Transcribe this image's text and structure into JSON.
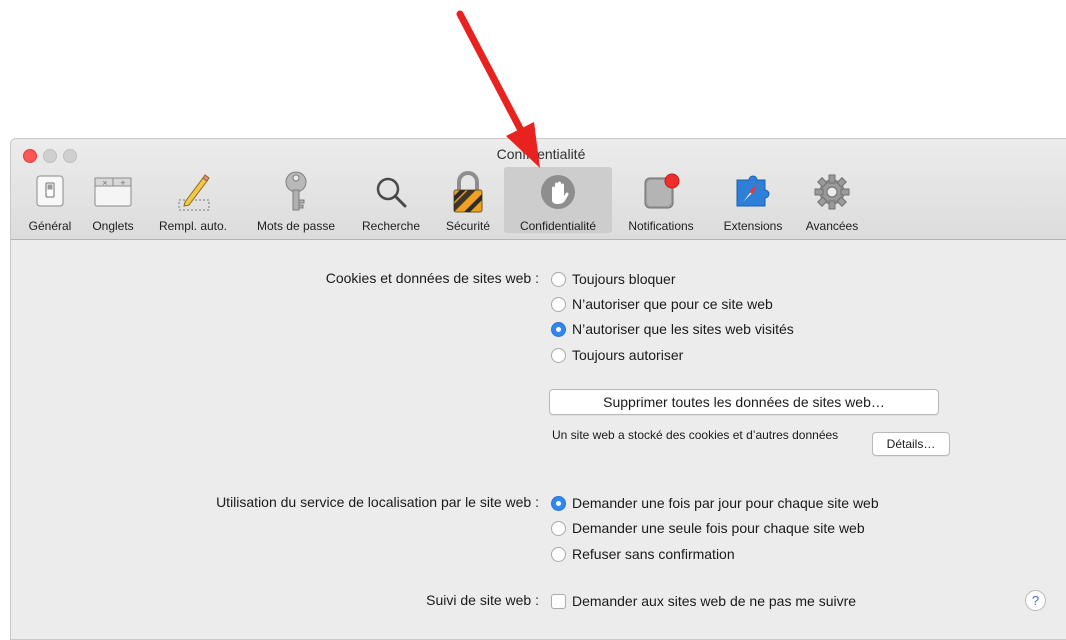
{
  "window": {
    "title": "Confidentialité"
  },
  "toolbar": {
    "items": [
      {
        "label": "Général",
        "icon": "general-switch-icon"
      },
      {
        "label": "Onglets",
        "icon": "tabs-icon"
      },
      {
        "label": "Rempl. auto.",
        "icon": "pencil-icon"
      },
      {
        "label": "Mots de passe",
        "icon": "key-icon"
      },
      {
        "label": "Recherche",
        "icon": "magnifier-icon"
      },
      {
        "label": "Sécurité",
        "icon": "padlock-icon"
      },
      {
        "label": "Confidentialité",
        "icon": "hand-icon",
        "selected": true
      },
      {
        "label": "Notifications",
        "icon": "notification-badge-icon"
      },
      {
        "label": "Extensions",
        "icon": "puzzle-compass-icon"
      },
      {
        "label": "Avancées",
        "icon": "gear-icon"
      }
    ]
  },
  "cookies": {
    "label": "Cookies et données de sites web :",
    "options": [
      {
        "label": "Toujours bloquer",
        "selected": false
      },
      {
        "label": "N’autoriser que pour ce site web",
        "selected": false
      },
      {
        "label": "N’autoriser que les sites web visités",
        "selected": true
      },
      {
        "label": "Toujours autoriser",
        "selected": false
      }
    ],
    "remove_button": "Supprimer toutes les données de sites web…",
    "stored_info": "Un site web a stocké des cookies et d’autres données",
    "details_button": "Détails…"
  },
  "location": {
    "label": "Utilisation du service de localisation par le site web :",
    "options": [
      {
        "label": "Demander une fois par jour pour chaque site web",
        "selected": true
      },
      {
        "label": "Demander une seule fois pour chaque site web",
        "selected": false
      },
      {
        "label": "Refuser sans confirmation",
        "selected": false
      }
    ]
  },
  "tracking": {
    "label": "Suivi de site web :",
    "checkbox_label": "Demander aux sites web de ne pas me suivre",
    "checked": false
  },
  "help_button": "?",
  "colors": {
    "accent": "#2f87ef",
    "annotation_arrow": "#e8231f",
    "close_button": "#fc5753"
  }
}
